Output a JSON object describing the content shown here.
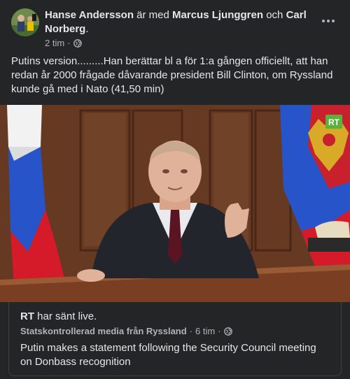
{
  "post": {
    "author": "Hanse Andersson",
    "with_text": "är med",
    "tagged_1": "Marcus Ljunggren",
    "and_text": "och",
    "tagged_2": "Carl Norberg",
    "period": ".",
    "time": "2 tim",
    "dot": "·",
    "privacy_icon": "globe-icon",
    "text": "Putins version.........Han berättar bl a för 1:a gången officiellt, att han redan år 2000 frågade dåvarande president Bill Clinton, om Ryssland kunde gå med i Nato (41,50 min)"
  },
  "video": {
    "channel_logo": "RT"
  },
  "shared": {
    "source": "RT",
    "action": "har sänt live.",
    "label": "Statskontrollerad media från Ryssland",
    "dot": "·",
    "time": "6 tim",
    "privacy_icon": "globe-icon",
    "title": "Putin makes a statement following the Security Council meeting on Donbass recognition"
  },
  "colors": {
    "background": "#242526",
    "text": "#e4e6eb",
    "secondary_text": "#b0b3b8",
    "border": "#3e4042"
  }
}
